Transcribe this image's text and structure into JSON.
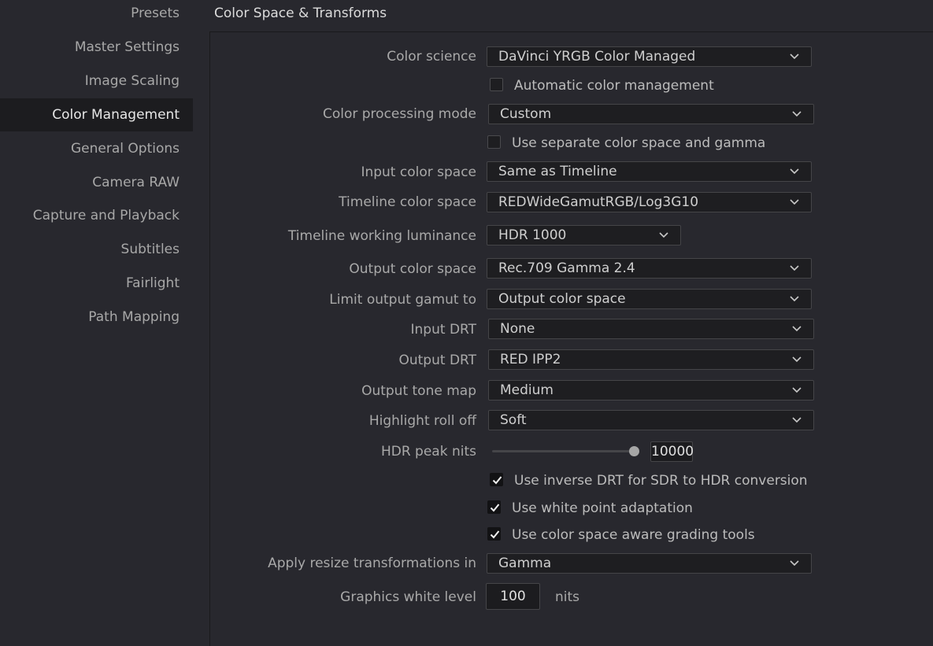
{
  "sidebar": {
    "items": [
      {
        "label": "Presets"
      },
      {
        "label": "Master Settings"
      },
      {
        "label": "Image Scaling"
      },
      {
        "label": "Color Management",
        "active": true
      },
      {
        "label": "General Options"
      },
      {
        "label": "Camera RAW"
      },
      {
        "label": "Capture and Playback"
      },
      {
        "label": "Subtitles"
      },
      {
        "label": "Fairlight"
      },
      {
        "label": "Path Mapping"
      }
    ]
  },
  "section": {
    "title": "Color Space & Transforms"
  },
  "settings": {
    "color_science": {
      "label": "Color science",
      "value": "DaVinci YRGB Color Managed"
    },
    "automatic_cm": {
      "label": "Automatic color management",
      "checked": false
    },
    "processing_mode": {
      "label": "Color processing mode",
      "value": "Custom"
    },
    "separate_cs_gamma": {
      "label": "Use separate color space and gamma",
      "checked": false
    },
    "input_color_space": {
      "label": "Input color space",
      "value": "Same as Timeline"
    },
    "timeline_color_space": {
      "label": "Timeline color space",
      "value": "REDWideGamutRGB/Log3G10"
    },
    "working_luminance": {
      "label": "Timeline working luminance",
      "value": "HDR 1000"
    },
    "output_color_space": {
      "label": "Output color space",
      "value": "Rec.709 Gamma 2.4"
    },
    "limit_output_gamut": {
      "label": "Limit output gamut to",
      "value": "Output color space"
    },
    "input_drt": {
      "label": "Input DRT",
      "value": "None"
    },
    "output_drt": {
      "label": "Output DRT",
      "value": "RED IPP2"
    },
    "output_tone_map": {
      "label": "Output tone map",
      "value": "Medium"
    },
    "highlight_roll_off": {
      "label": "Highlight roll off",
      "value": "Soft"
    },
    "hdr_peak_nits": {
      "label": "HDR peak nits",
      "value": "10000",
      "slider_fraction": 1.0
    },
    "inverse_drt": {
      "label": "Use inverse DRT for SDR to HDR conversion",
      "checked": true
    },
    "white_point_adaptation": {
      "label": "Use white point adaptation",
      "checked": true
    },
    "cs_aware_tools": {
      "label": "Use color space aware grading tools",
      "checked": true
    },
    "resize_transformations": {
      "label": "Apply resize transformations in",
      "value": "Gamma"
    },
    "graphics_white_level": {
      "label": "Graphics white level",
      "value": "100",
      "unit": "nits"
    }
  },
  "icons": {
    "dropdown": "chevron-down-icon",
    "check": "checkmark-icon"
  },
  "colors": {
    "background": "#28282e",
    "sidebar_active": "#1c1c1f",
    "field": "#1e1e21"
  }
}
